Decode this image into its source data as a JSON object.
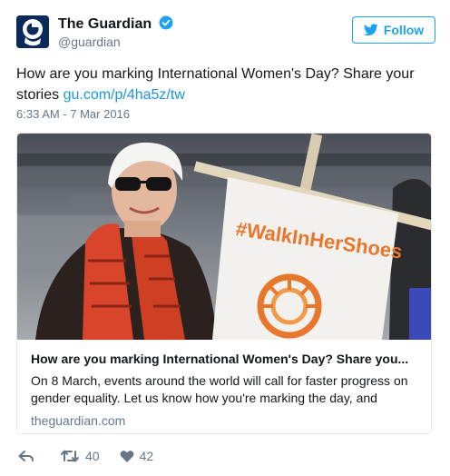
{
  "account": {
    "display_name": "The Guardian",
    "handle": "@guardian",
    "follow_label": "Follow"
  },
  "tweet": {
    "text": "How are you marking International Women's Day? Share your stories ",
    "link": "gu.com/p/4ha5z/tw",
    "timestamp": "6:33 AM - 7 Mar 2016"
  },
  "card": {
    "banner_text": "#WalkInHerShoes",
    "title": "How are you marking International Women's Day? Share you...",
    "description": "On 8 March, events around the world will call for faster progress on gender equality. Let us know how you're marking the day, and",
    "domain": "theguardian.com"
  },
  "actions": {
    "retweets": "40",
    "likes": "42"
  },
  "icons": {
    "avatar": "guardian-logo-icon",
    "verified": "verified-badge-icon",
    "follow": "twitter-bird-icon",
    "reply": "reply-icon",
    "retweet": "retweet-icon",
    "like": "heart-icon"
  },
  "colors": {
    "accent": "#1da1f2",
    "link": "#1b95e0",
    "muted": "#657786",
    "avatar_bg": "#0a2a5c",
    "banner_text": "#e8772e"
  }
}
